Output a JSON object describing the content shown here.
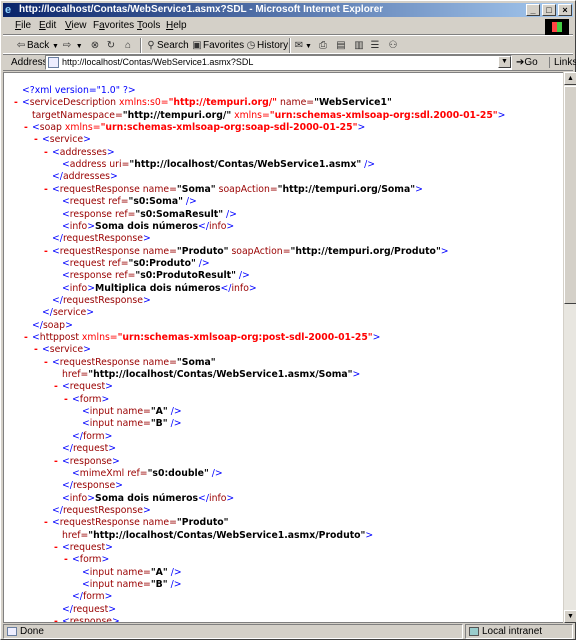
{
  "window": {
    "title": "http://localhost/Contas/WebService1.asmx?SDL - Microsoft Internet Explorer",
    "icon": "ie-icon",
    "controls": [
      "minimize-icon",
      "maximize-icon",
      "close-icon"
    ]
  },
  "menu": [
    {
      "label": "File",
      "key": "F"
    },
    {
      "label": "Edit",
      "key": "E"
    },
    {
      "label": "View",
      "key": "V"
    },
    {
      "label": "Favorites",
      "key": "a"
    },
    {
      "label": "Tools",
      "key": "T"
    },
    {
      "label": "Help",
      "key": "H"
    }
  ],
  "toolbar": {
    "back_label": "Back",
    "search_label": "Search",
    "favorites_label": "Favorites",
    "history_label": "History"
  },
  "address": {
    "label": "Address",
    "value": "http://localhost/Contas/WebService1.asmx?SDL",
    "go_label": "Go",
    "links_label": "Links"
  },
  "xml_lines": [
    {
      "indent": 0,
      "collapsible": false,
      "parts": [
        [
          "pi",
          "<?xml version=\"1.0\" ?>"
        ]
      ]
    },
    {
      "indent": 0,
      "collapsible": true,
      "parts": [
        [
          "bracket",
          "<"
        ],
        [
          "tag",
          "serviceDescription"
        ],
        [
          "nsattr",
          " xmlns:s0="
        ],
        [
          "nsval",
          "\"http://tempuri.org/\""
        ],
        [
          "attr",
          " name="
        ],
        [
          "val",
          "\"WebService1\""
        ]
      ]
    },
    {
      "indent": 1,
      "collapsible": false,
      "parts": [
        [
          "attr",
          "targetNamespace="
        ],
        [
          "val",
          "\"http://tempuri.org/\""
        ],
        [
          "nsattr",
          " xmlns="
        ],
        [
          "nsval",
          "\"urn:schemas-xmlsoap-org:sdl.2000-01-25\""
        ],
        [
          "bracket",
          ">"
        ]
      ]
    },
    {
      "indent": 1,
      "collapsible": true,
      "parts": [
        [
          "bracket",
          "<"
        ],
        [
          "tag",
          "soap"
        ],
        [
          "nsattr",
          " xmlns="
        ],
        [
          "nsval",
          "\"urn:schemas-xmlsoap-org:soap-sdl-2000-01-25\""
        ],
        [
          "bracket",
          ">"
        ]
      ]
    },
    {
      "indent": 2,
      "collapsible": true,
      "parts": [
        [
          "bracket",
          "<"
        ],
        [
          "tag",
          "service"
        ],
        [
          "bracket",
          ">"
        ]
      ]
    },
    {
      "indent": 3,
      "collapsible": true,
      "parts": [
        [
          "bracket",
          "<"
        ],
        [
          "tag",
          "addresses"
        ],
        [
          "bracket",
          ">"
        ]
      ]
    },
    {
      "indent": 4,
      "collapsible": false,
      "parts": [
        [
          "bracket",
          "<"
        ],
        [
          "tag",
          "address"
        ],
        [
          "attr",
          " uri="
        ],
        [
          "val",
          "\"http://localhost/Contas/WebService1.asmx\""
        ],
        [
          "bracket",
          " />"
        ]
      ]
    },
    {
      "indent": 3,
      "collapsible": false,
      "parts": [
        [
          "bracket",
          "</"
        ],
        [
          "tag",
          "addresses"
        ],
        [
          "bracket",
          ">"
        ]
      ]
    },
    {
      "indent": 3,
      "collapsible": true,
      "parts": [
        [
          "bracket",
          "<"
        ],
        [
          "tag",
          "requestResponse"
        ],
        [
          "attr",
          " name="
        ],
        [
          "val",
          "\"Soma\""
        ],
        [
          "attr",
          " soapAction="
        ],
        [
          "val",
          "\"http://tempuri.org/Soma\""
        ],
        [
          "bracket",
          ">"
        ]
      ]
    },
    {
      "indent": 4,
      "collapsible": false,
      "parts": [
        [
          "bracket",
          "<"
        ],
        [
          "tag",
          "request"
        ],
        [
          "attr",
          " ref="
        ],
        [
          "val",
          "\"s0:Soma\""
        ],
        [
          "bracket",
          " />"
        ]
      ]
    },
    {
      "indent": 4,
      "collapsible": false,
      "parts": [
        [
          "bracket",
          "<"
        ],
        [
          "tag",
          "response"
        ],
        [
          "attr",
          " ref="
        ],
        [
          "val",
          "\"s0:SomaResult\""
        ],
        [
          "bracket",
          " />"
        ]
      ]
    },
    {
      "indent": 4,
      "collapsible": false,
      "parts": [
        [
          "bracket",
          "<"
        ],
        [
          "tag",
          "info"
        ],
        [
          "bracket",
          ">"
        ],
        [
          "text",
          "Soma dois números"
        ],
        [
          "bracket",
          "</"
        ],
        [
          "tag",
          "info"
        ],
        [
          "bracket",
          ">"
        ]
      ]
    },
    {
      "indent": 3,
      "collapsible": false,
      "parts": [
        [
          "bracket",
          "</"
        ],
        [
          "tag",
          "requestResponse"
        ],
        [
          "bracket",
          ">"
        ]
      ]
    },
    {
      "indent": 3,
      "collapsible": true,
      "parts": [
        [
          "bracket",
          "<"
        ],
        [
          "tag",
          "requestResponse"
        ],
        [
          "attr",
          " name="
        ],
        [
          "val",
          "\"Produto\""
        ],
        [
          "attr",
          " soapAction="
        ],
        [
          "val",
          "\"http://tempuri.org/Produto\""
        ],
        [
          "bracket",
          ">"
        ]
      ]
    },
    {
      "indent": 4,
      "collapsible": false,
      "parts": [
        [
          "bracket",
          "<"
        ],
        [
          "tag",
          "request"
        ],
        [
          "attr",
          " ref="
        ],
        [
          "val",
          "\"s0:Produto\""
        ],
        [
          "bracket",
          " />"
        ]
      ]
    },
    {
      "indent": 4,
      "collapsible": false,
      "parts": [
        [
          "bracket",
          "<"
        ],
        [
          "tag",
          "response"
        ],
        [
          "attr",
          " ref="
        ],
        [
          "val",
          "\"s0:ProdutoResult\""
        ],
        [
          "bracket",
          " />"
        ]
      ]
    },
    {
      "indent": 4,
      "collapsible": false,
      "parts": [
        [
          "bracket",
          "<"
        ],
        [
          "tag",
          "info"
        ],
        [
          "bracket",
          ">"
        ],
        [
          "text",
          "Multiplica dois números"
        ],
        [
          "bracket",
          "</"
        ],
        [
          "tag",
          "info"
        ],
        [
          "bracket",
          ">"
        ]
      ]
    },
    {
      "indent": 3,
      "collapsible": false,
      "parts": [
        [
          "bracket",
          "</"
        ],
        [
          "tag",
          "requestResponse"
        ],
        [
          "bracket",
          ">"
        ]
      ]
    },
    {
      "indent": 2,
      "collapsible": false,
      "parts": [
        [
          "bracket",
          "</"
        ],
        [
          "tag",
          "service"
        ],
        [
          "bracket",
          ">"
        ]
      ]
    },
    {
      "indent": 1,
      "collapsible": false,
      "parts": [
        [
          "bracket",
          "</"
        ],
        [
          "tag",
          "soap"
        ],
        [
          "bracket",
          ">"
        ]
      ]
    },
    {
      "indent": 1,
      "collapsible": true,
      "parts": [
        [
          "bracket",
          "<"
        ],
        [
          "tag",
          "httppost"
        ],
        [
          "nsattr",
          " xmlns="
        ],
        [
          "nsval",
          "\"urn:schemas-xmlsoap-org:post-sdl-2000-01-25\""
        ],
        [
          "bracket",
          ">"
        ]
      ]
    },
    {
      "indent": 2,
      "collapsible": true,
      "parts": [
        [
          "bracket",
          "<"
        ],
        [
          "tag",
          "service"
        ],
        [
          "bracket",
          ">"
        ]
      ]
    },
    {
      "indent": 3,
      "collapsible": true,
      "parts": [
        [
          "bracket",
          "<"
        ],
        [
          "tag",
          "requestResponse"
        ],
        [
          "attr",
          " name="
        ],
        [
          "val",
          "\"Soma\""
        ]
      ]
    },
    {
      "indent": 4,
      "collapsible": false,
      "parts": [
        [
          "attr",
          "href="
        ],
        [
          "val",
          "\"http://localhost/Contas/WebService1.asmx/Soma\""
        ],
        [
          "bracket",
          ">"
        ]
      ]
    },
    {
      "indent": 4,
      "collapsible": true,
      "parts": [
        [
          "bracket",
          "<"
        ],
        [
          "tag",
          "request"
        ],
        [
          "bracket",
          ">"
        ]
      ]
    },
    {
      "indent": 5,
      "collapsible": true,
      "parts": [
        [
          "bracket",
          "<"
        ],
        [
          "tag",
          "form"
        ],
        [
          "bracket",
          ">"
        ]
      ]
    },
    {
      "indent": 6,
      "collapsible": false,
      "parts": [
        [
          "bracket",
          "<"
        ],
        [
          "tag",
          "input"
        ],
        [
          "attr",
          " name="
        ],
        [
          "val",
          "\"A\""
        ],
        [
          "bracket",
          " />"
        ]
      ]
    },
    {
      "indent": 6,
      "collapsible": false,
      "parts": [
        [
          "bracket",
          "<"
        ],
        [
          "tag",
          "input"
        ],
        [
          "attr",
          " name="
        ],
        [
          "val",
          "\"B\""
        ],
        [
          "bracket",
          " />"
        ]
      ]
    },
    {
      "indent": 5,
      "collapsible": false,
      "parts": [
        [
          "bracket",
          "</"
        ],
        [
          "tag",
          "form"
        ],
        [
          "bracket",
          ">"
        ]
      ]
    },
    {
      "indent": 4,
      "collapsible": false,
      "parts": [
        [
          "bracket",
          "</"
        ],
        [
          "tag",
          "request"
        ],
        [
          "bracket",
          ">"
        ]
      ]
    },
    {
      "indent": 4,
      "collapsible": true,
      "parts": [
        [
          "bracket",
          "<"
        ],
        [
          "tag",
          "response"
        ],
        [
          "bracket",
          ">"
        ]
      ]
    },
    {
      "indent": 5,
      "collapsible": false,
      "parts": [
        [
          "bracket",
          "<"
        ],
        [
          "tag",
          "mimeXml"
        ],
        [
          "attr",
          " ref="
        ],
        [
          "val",
          "\"s0:double\""
        ],
        [
          "bracket",
          " />"
        ]
      ]
    },
    {
      "indent": 4,
      "collapsible": false,
      "parts": [
        [
          "bracket",
          "</"
        ],
        [
          "tag",
          "response"
        ],
        [
          "bracket",
          ">"
        ]
      ]
    },
    {
      "indent": 4,
      "collapsible": false,
      "parts": [
        [
          "bracket",
          "<"
        ],
        [
          "tag",
          "info"
        ],
        [
          "bracket",
          ">"
        ],
        [
          "text",
          "Soma dois números"
        ],
        [
          "bracket",
          "</"
        ],
        [
          "tag",
          "info"
        ],
        [
          "bracket",
          ">"
        ]
      ]
    },
    {
      "indent": 3,
      "collapsible": false,
      "parts": [
        [
          "bracket",
          "</"
        ],
        [
          "tag",
          "requestResponse"
        ],
        [
          "bracket",
          ">"
        ]
      ]
    },
    {
      "indent": 3,
      "collapsible": true,
      "parts": [
        [
          "bracket",
          "<"
        ],
        [
          "tag",
          "requestResponse"
        ],
        [
          "attr",
          " name="
        ],
        [
          "val",
          "\"Produto\""
        ]
      ]
    },
    {
      "indent": 4,
      "collapsible": false,
      "parts": [
        [
          "attr",
          "href="
        ],
        [
          "val",
          "\"http://localhost/Contas/WebService1.asmx/Produto\""
        ],
        [
          "bracket",
          ">"
        ]
      ]
    },
    {
      "indent": 4,
      "collapsible": true,
      "parts": [
        [
          "bracket",
          "<"
        ],
        [
          "tag",
          "request"
        ],
        [
          "bracket",
          ">"
        ]
      ]
    },
    {
      "indent": 5,
      "collapsible": true,
      "parts": [
        [
          "bracket",
          "<"
        ],
        [
          "tag",
          "form"
        ],
        [
          "bracket",
          ">"
        ]
      ]
    },
    {
      "indent": 6,
      "collapsible": false,
      "parts": [
        [
          "bracket",
          "<"
        ],
        [
          "tag",
          "input"
        ],
        [
          "attr",
          " name="
        ],
        [
          "val",
          "\"A\""
        ],
        [
          "bracket",
          " />"
        ]
      ]
    },
    {
      "indent": 6,
      "collapsible": false,
      "parts": [
        [
          "bracket",
          "<"
        ],
        [
          "tag",
          "input"
        ],
        [
          "attr",
          " name="
        ],
        [
          "val",
          "\"B\""
        ],
        [
          "bracket",
          " />"
        ]
      ]
    },
    {
      "indent": 5,
      "collapsible": false,
      "parts": [
        [
          "bracket",
          "</"
        ],
        [
          "tag",
          "form"
        ],
        [
          "bracket",
          ">"
        ]
      ]
    },
    {
      "indent": 4,
      "collapsible": false,
      "parts": [
        [
          "bracket",
          "</"
        ],
        [
          "tag",
          "request"
        ],
        [
          "bracket",
          ">"
        ]
      ]
    },
    {
      "indent": 4,
      "collapsible": true,
      "parts": [
        [
          "bracket",
          "<"
        ],
        [
          "tag",
          "response"
        ],
        [
          "bracket",
          ">"
        ]
      ]
    }
  ],
  "status": {
    "text": "Done",
    "zone": "Local intranet"
  }
}
